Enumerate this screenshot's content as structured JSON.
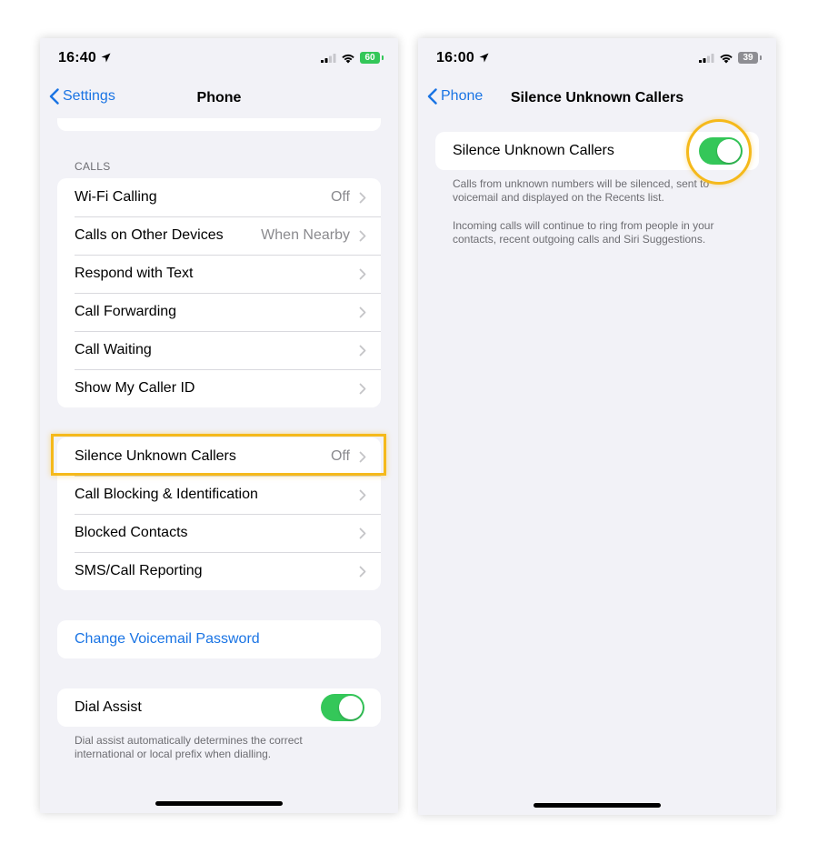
{
  "colors": {
    "accent": "#1a74e4",
    "toggle_on": "#34c759",
    "highlight": "#f5b91b",
    "battery_green": "#34c759",
    "battery_gray": "#8e8e93"
  },
  "left": {
    "status": {
      "time": "16:40",
      "battery": "60"
    },
    "nav": {
      "back_label": "Settings",
      "title": "Phone"
    },
    "calls_header": "CALLS",
    "calls_rows": [
      {
        "label": "Wi-Fi Calling",
        "value": "Off"
      },
      {
        "label": "Calls on Other Devices",
        "value": "When Nearby"
      },
      {
        "label": "Respond with Text",
        "value": ""
      },
      {
        "label": "Call Forwarding",
        "value": ""
      },
      {
        "label": "Call Waiting",
        "value": ""
      },
      {
        "label": "Show My Caller ID",
        "value": ""
      }
    ],
    "blocking_rows": [
      {
        "label": "Silence Unknown Callers",
        "value": "Off"
      },
      {
        "label": "Call Blocking & Identification",
        "value": ""
      },
      {
        "label": "Blocked Contacts",
        "value": ""
      },
      {
        "label": "SMS/Call Reporting",
        "value": ""
      }
    ],
    "voicemail_link": "Change Voicemail Password",
    "dial_assist": {
      "label": "Dial Assist",
      "on": true,
      "footnote": "Dial assist automatically determines the correct international or local prefix when dialling."
    }
  },
  "right": {
    "status": {
      "time": "16:00",
      "battery": "39"
    },
    "nav": {
      "back_label": "Phone",
      "title": "Silence Unknown Callers"
    },
    "toggle_row": {
      "label": "Silence Unknown Callers",
      "on": true
    },
    "footnote_1": "Calls from unknown numbers will be silenced, sent to voicemail and displayed on the Recents list.",
    "footnote_2": "Incoming calls will continue to ring from people in your contacts, recent outgoing calls and Siri Suggestions."
  }
}
